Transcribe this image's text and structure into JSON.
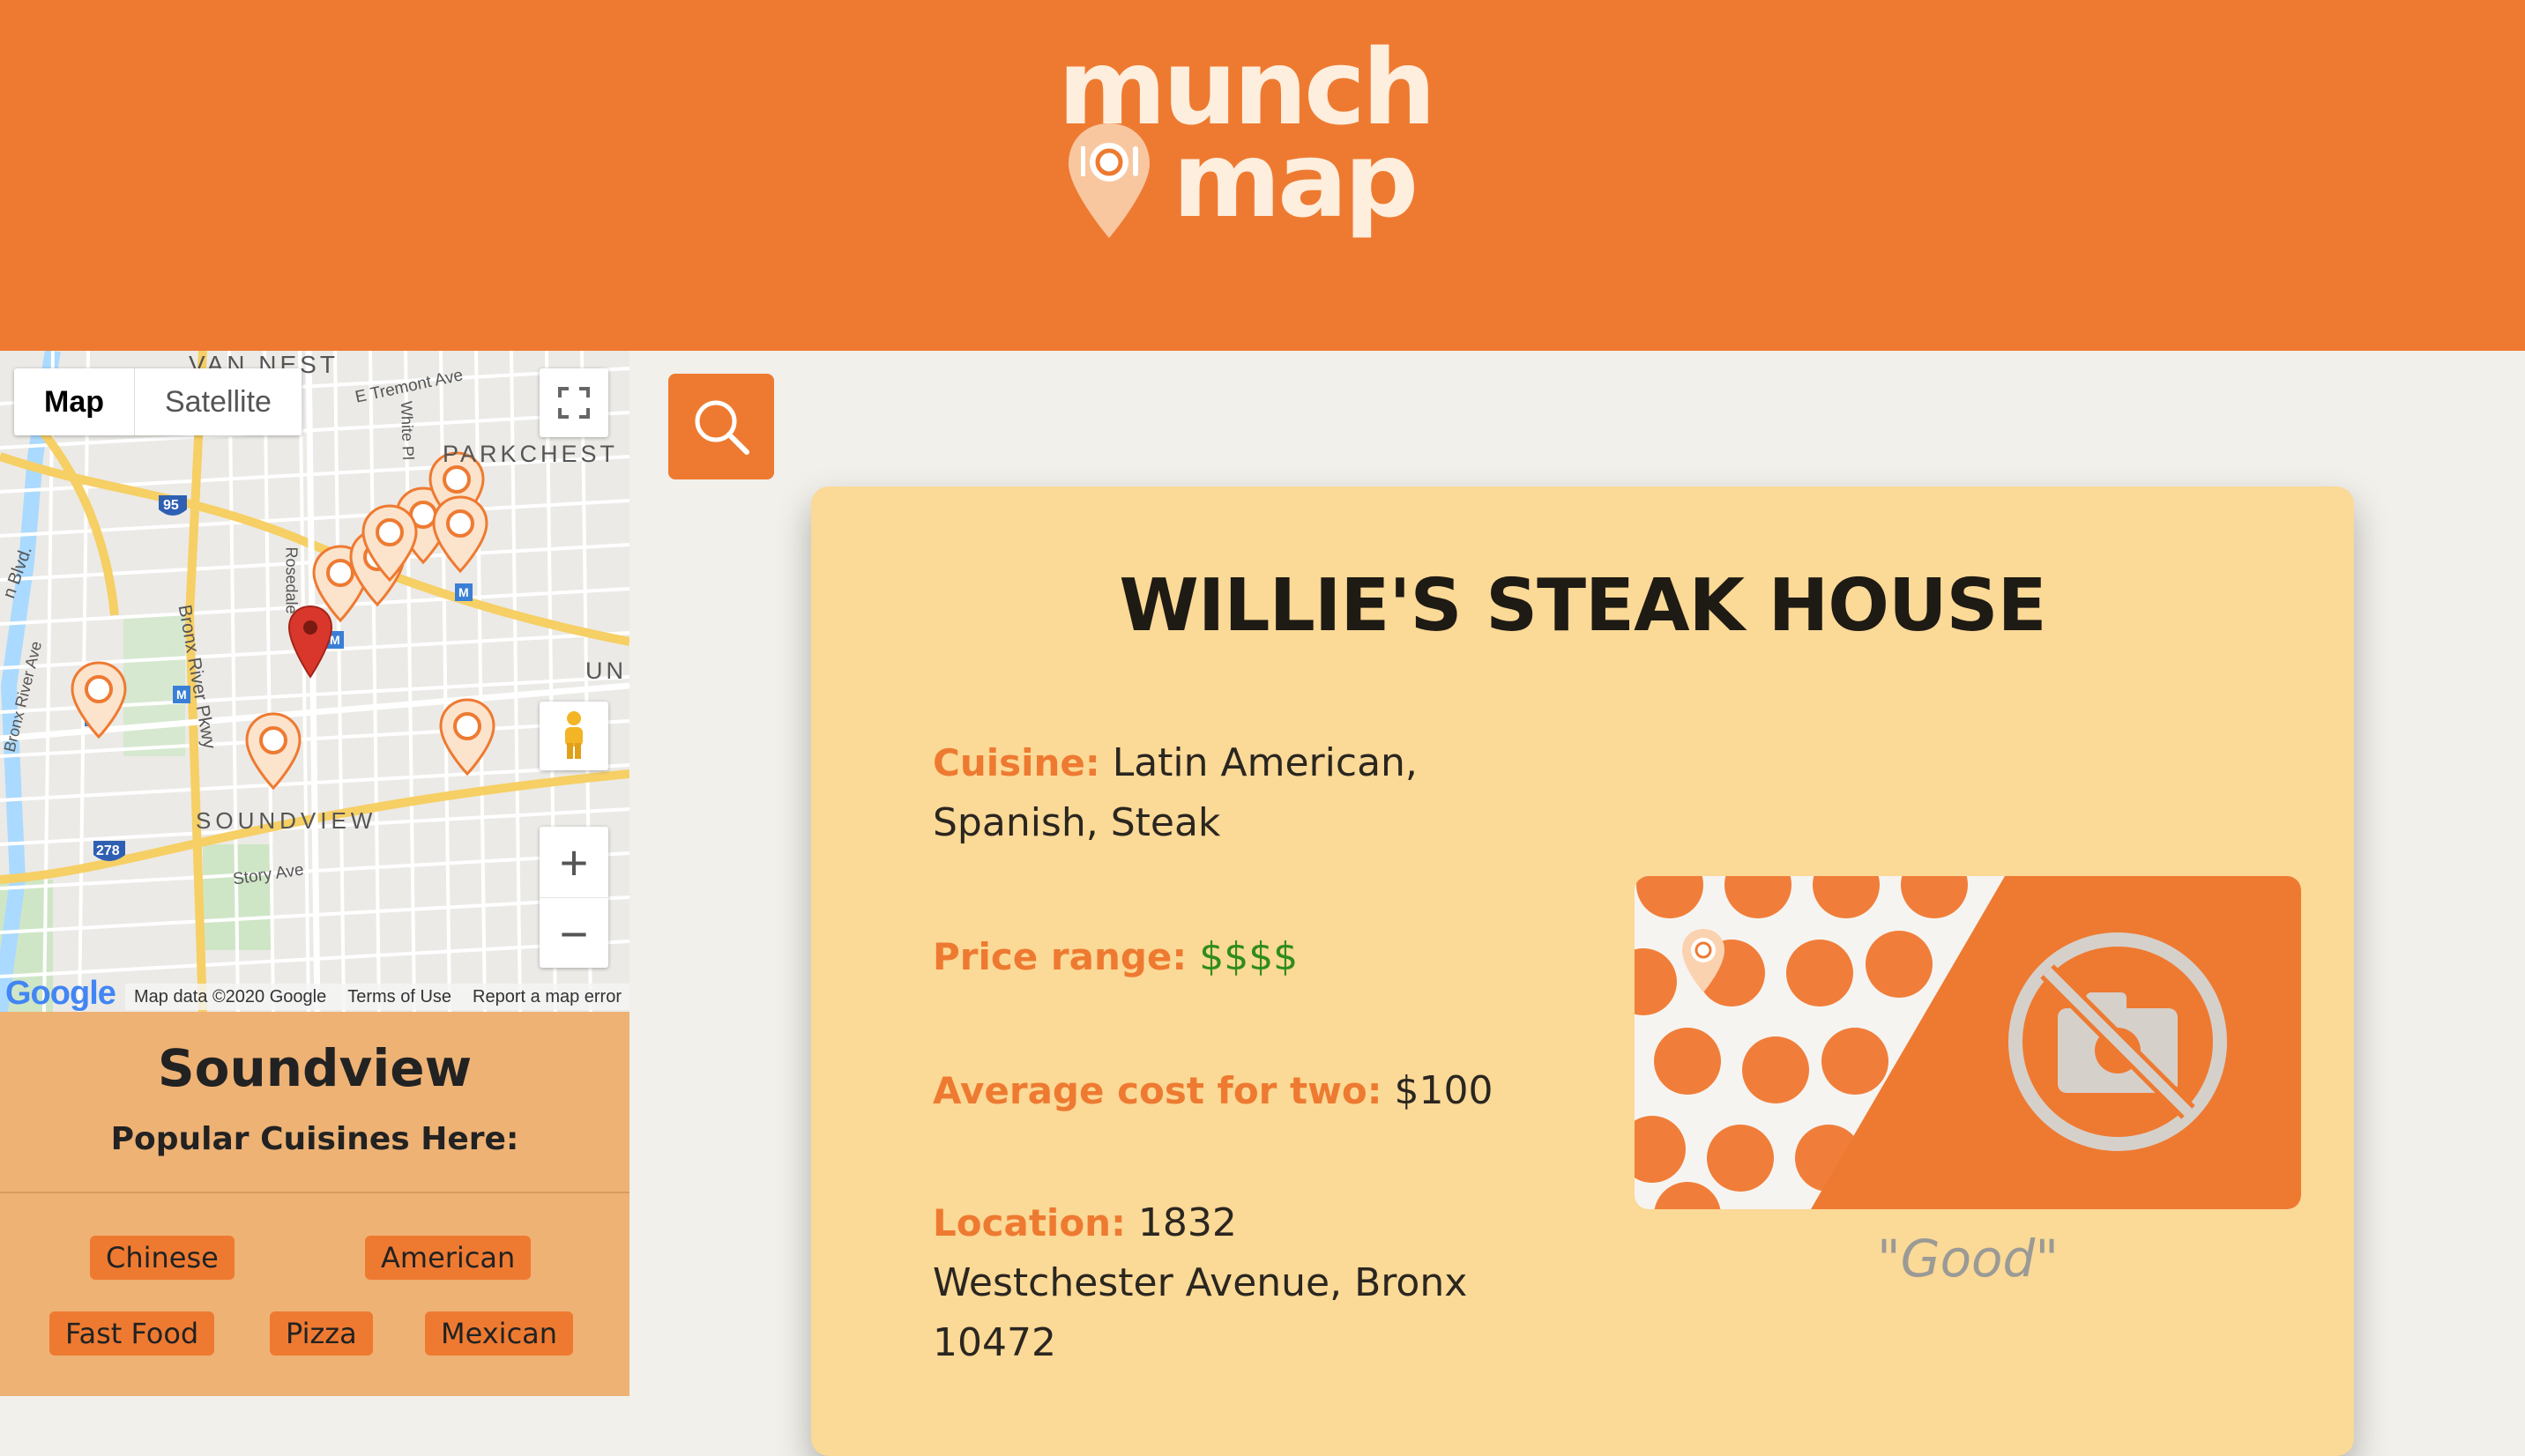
{
  "brand": {
    "logo_line1": "munch",
    "logo_line2": "map",
    "accent_color": "#ee7a31"
  },
  "map": {
    "type_options": [
      "Map",
      "Satellite"
    ],
    "selected_type": "Map",
    "labels": {
      "van_nest": "VAN NEST",
      "tremont": "E Tremont Ave",
      "parkchester": "PARKCHEST",
      "white_plains": "White Pl",
      "rosedale": "Rosedale",
      "bronx_river_pkwy": "Bronx River Pkwy",
      "bronx_river_ave": "Bronx River Ave",
      "blvd": "n Blvd.",
      "un": "UN",
      "soundview": "SOUNDVIEW",
      "story_ave": "Story Ave",
      "highway_95": "95",
      "highway_278": "278"
    },
    "attribution": {
      "google": "Google",
      "map_data": "Map data ©2020 Google",
      "terms": "Terms of Use",
      "report": "Report a map error"
    },
    "zoom_in": "+",
    "zoom_out": "−"
  },
  "neighborhood": {
    "name": "Soundview",
    "subtitle": "Popular Cuisines Here:",
    "cuisines": [
      "Chinese",
      "American",
      "Fast Food",
      "Pizza",
      "Mexican"
    ]
  },
  "restaurant": {
    "name": "WILLIE'S STEAK HOUSE",
    "cuisine_label": "Cuisine:",
    "cuisine_value": "Latin American, Spanish, Steak",
    "price_label": "Price range:",
    "price_value": "$$$$",
    "cost_label": "Average cost for two:",
    "cost_value": "$100",
    "location_label": "Location:",
    "location_value": "1832 Westchester Avenue, Bronx 10472",
    "rating": "\"Good\""
  }
}
